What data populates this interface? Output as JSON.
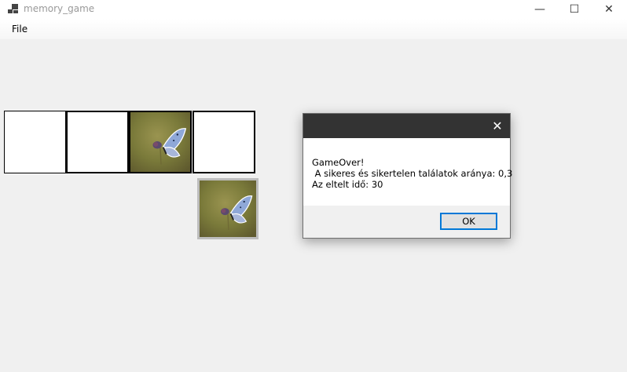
{
  "window": {
    "title": "memory_game",
    "minimize_glyph": "—",
    "maximize_glyph": "☐",
    "close_glyph": "✕"
  },
  "menu": {
    "items": [
      {
        "label": "File"
      }
    ]
  },
  "board": {
    "cards": [
      {
        "state": "hidden"
      },
      {
        "state": "hidden"
      },
      {
        "state": "revealed",
        "image": "butterfly"
      },
      {
        "state": "hidden"
      }
    ],
    "preview": {
      "image": "butterfly"
    }
  },
  "dialog": {
    "close_glyph": "✕",
    "line1": "GameOver!",
    "line2": " A sikeres és sikertelen találatok aránya: 0,3",
    "line3": "Az eltelt idő: 30",
    "ok_label": "OK",
    "accent_color": "#0078d7",
    "header_color": "#333333"
  }
}
